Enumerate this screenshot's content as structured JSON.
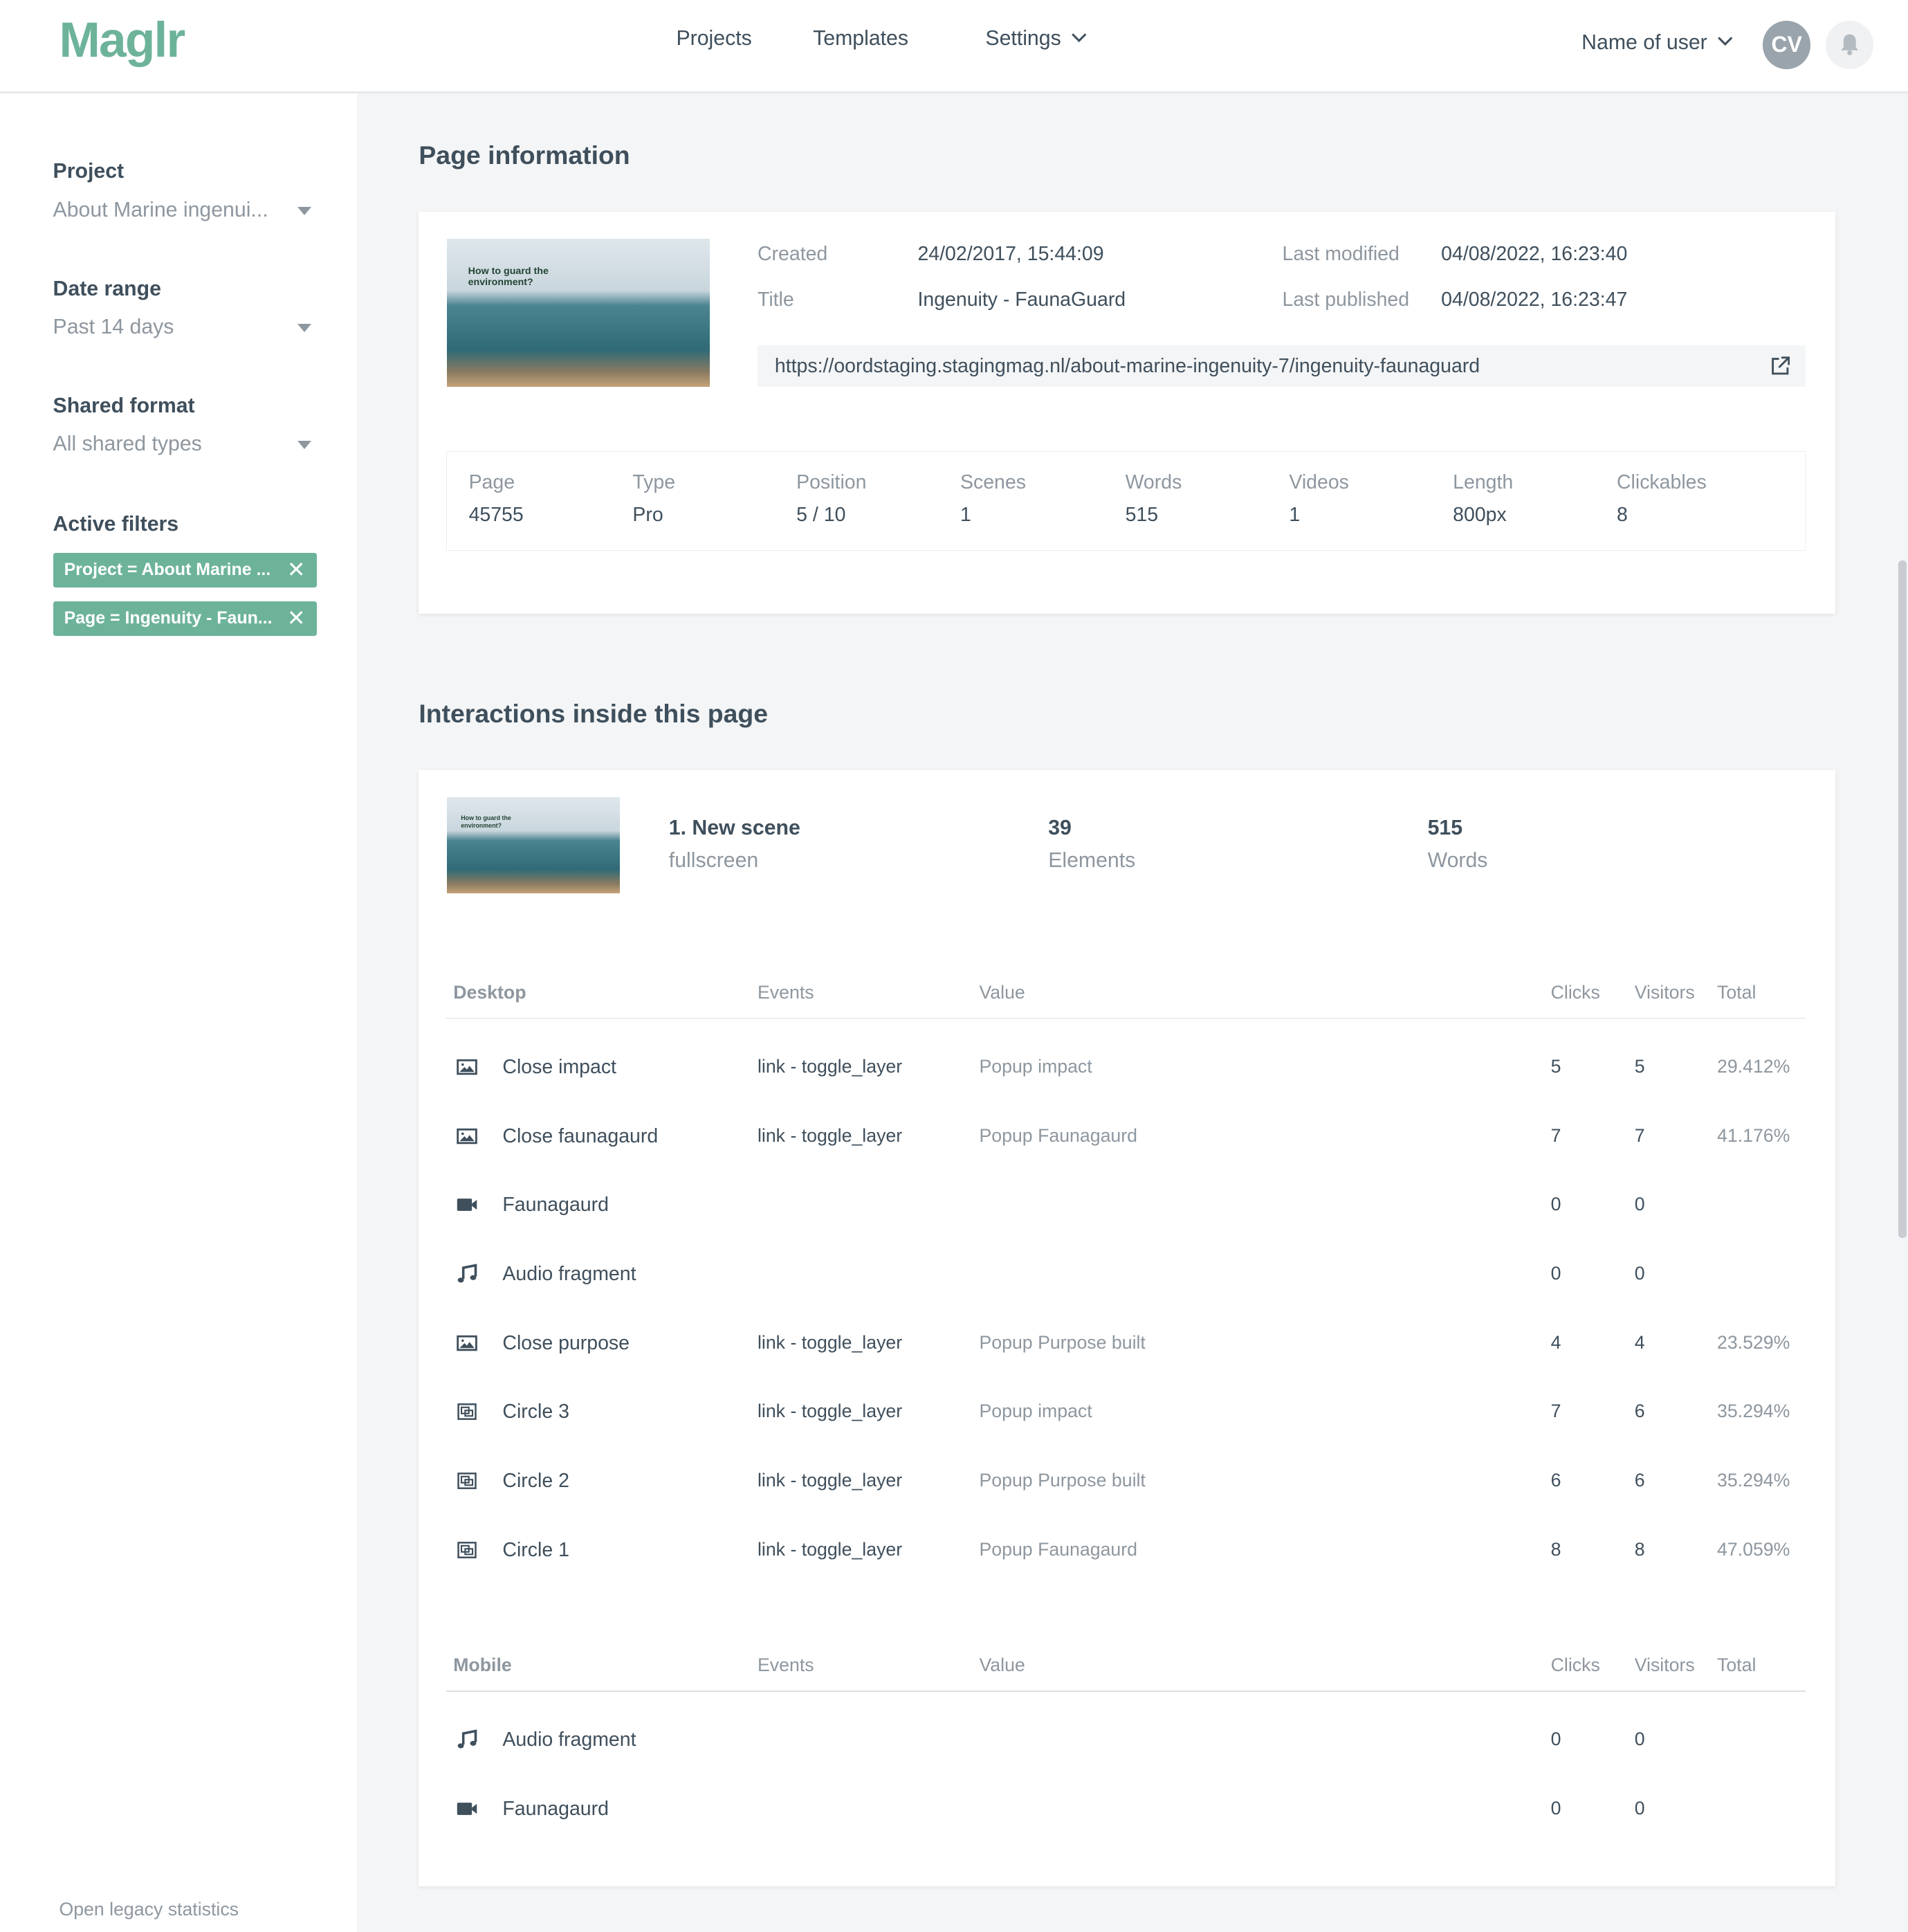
{
  "header": {
    "logo": "Maglr",
    "nav": [
      "Projects",
      "Templates",
      "Settings"
    ],
    "user_name": "Name of user",
    "avatar_initials": "CV"
  },
  "sidebar": {
    "filters": [
      {
        "label": "Project",
        "value": "About Marine ingenui..."
      },
      {
        "label": "Date range",
        "value": "Past 14 days"
      },
      {
        "label": "Shared format",
        "value": "All shared types"
      }
    ],
    "active_filters_label": "Active filters",
    "chips": [
      "Project = About Marine ...",
      "Page = Ingenuity - Faun..."
    ],
    "legacy_link": "Open legacy statistics"
  },
  "page_info": {
    "heading": "Page information",
    "thumb_title": "How to guard the environment?",
    "created_label": "Created",
    "created": "24/02/2017, 15:44:09",
    "title_label": "Title",
    "title": "Ingenuity - FaunaGuard",
    "modified_label": "Last modified",
    "modified": "04/08/2022, 16:23:40",
    "published_label": "Last published",
    "published": "04/08/2022, 16:23:47",
    "url": "https://oordstaging.stagingmag.nl/about-marine-ingenuity-7/ingenuity-faunaguard",
    "stats": [
      {
        "label": "Page",
        "value": "45755"
      },
      {
        "label": "Type",
        "value": "Pro"
      },
      {
        "label": "Position",
        "value": "5 / 10"
      },
      {
        "label": "Scenes",
        "value": "1"
      },
      {
        "label": "Words",
        "value": "515"
      },
      {
        "label": "Videos",
        "value": "1"
      },
      {
        "label": "Length",
        "value": "800px"
      },
      {
        "label": "Clickables",
        "value": "8"
      }
    ]
  },
  "interactions": {
    "heading": "Interactions inside this page",
    "scene": {
      "title": "1. New scene",
      "subtitle": "fullscreen",
      "elements": "39",
      "elements_label": "Elements",
      "words": "515",
      "words_label": "Words"
    },
    "columns": {
      "events": "Events",
      "value": "Value",
      "clicks": "Clicks",
      "visitors": "Visitors",
      "total": "Total"
    },
    "desktop": {
      "label": "Desktop",
      "rows": [
        {
          "icon": "image-icon",
          "name": "Close impact",
          "event": "link - toggle_layer",
          "value": "Popup impact",
          "clicks": "5",
          "visitors": "5",
          "total": "29.412%"
        },
        {
          "icon": "image-icon",
          "name": "Close faunagaurd",
          "event": "link - toggle_layer",
          "value": "Popup Faunagaurd",
          "clicks": "7",
          "visitors": "7",
          "total": "41.176%"
        },
        {
          "icon": "video-icon",
          "name": "Faunagaurd",
          "event": "",
          "value": "",
          "clicks": "0",
          "visitors": "0",
          "total": ""
        },
        {
          "icon": "music-icon",
          "name": "Audio fragment",
          "event": "",
          "value": "",
          "clicks": "0",
          "visitors": "0",
          "total": ""
        },
        {
          "icon": "image-icon",
          "name": "Close purpose",
          "event": "link - toggle_layer",
          "value": "Popup Purpose built",
          "clicks": "4",
          "visitors": "4",
          "total": "23.529%"
        },
        {
          "icon": "shape-icon",
          "name": "Circle 3",
          "event": "link - toggle_layer",
          "value": "Popup impact",
          "clicks": "7",
          "visitors": "6",
          "total": "35.294%"
        },
        {
          "icon": "shape-icon",
          "name": "Circle 2",
          "event": "link - toggle_layer",
          "value": "Popup Purpose built",
          "clicks": "6",
          "visitors": "6",
          "total": "35.294%"
        },
        {
          "icon": "shape-icon",
          "name": "Circle 1",
          "event": "link - toggle_layer",
          "value": "Popup Faunagaurd",
          "clicks": "8",
          "visitors": "8",
          "total": "47.059%"
        }
      ]
    },
    "mobile": {
      "label": "Mobile",
      "rows": [
        {
          "icon": "music-icon",
          "name": "Audio fragment",
          "event": "",
          "value": "",
          "clicks": "0",
          "visitors": "0",
          "total": ""
        },
        {
          "icon": "video-icon",
          "name": "Faunagaurd",
          "event": "",
          "value": "",
          "clicks": "0",
          "visitors": "0",
          "total": ""
        }
      ]
    }
  },
  "colors": {
    "accent": "#6db39a",
    "text": "#3f4f5c",
    "muted": "#8e979f",
    "background": "#f4f5f6"
  }
}
